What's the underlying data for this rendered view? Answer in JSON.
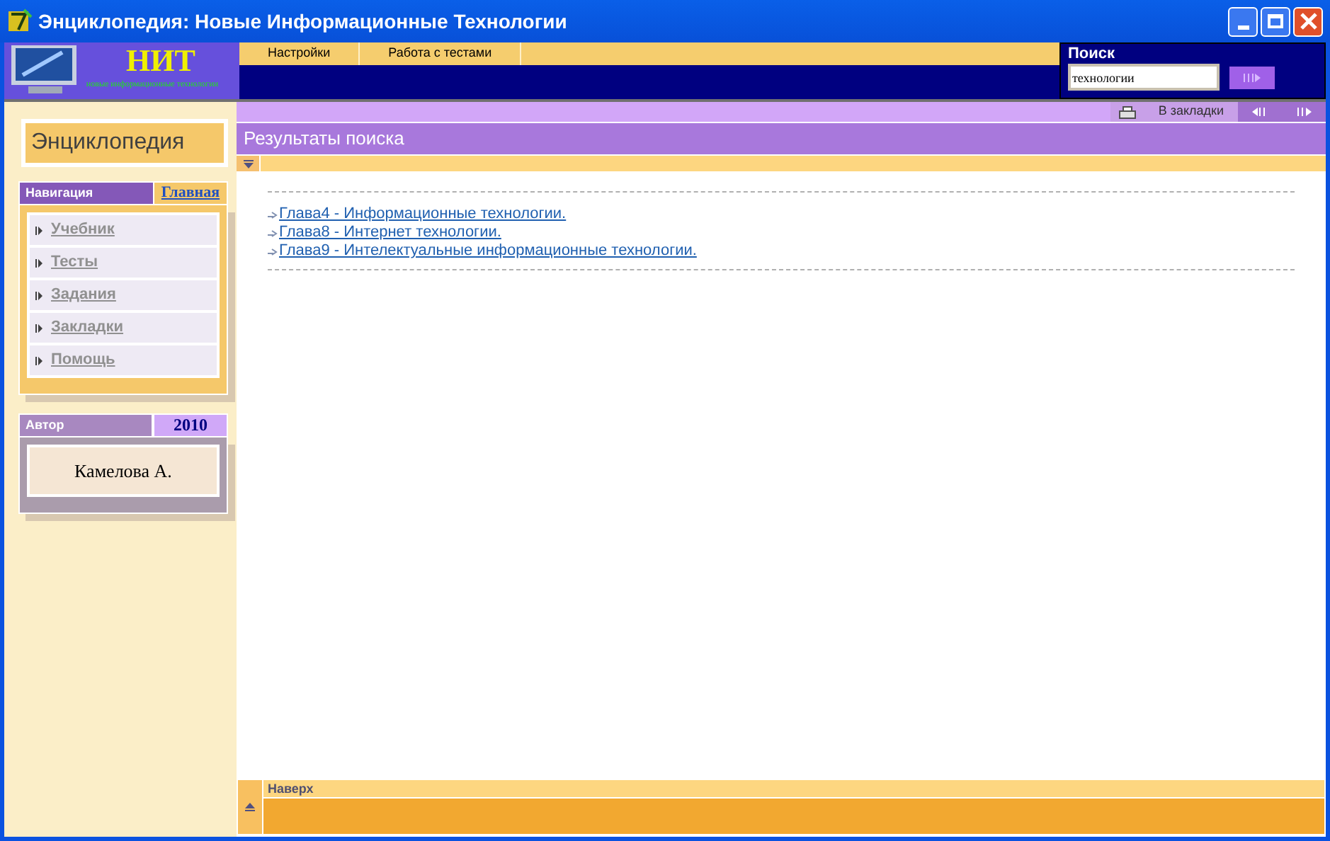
{
  "window": {
    "title": "Энциклопедия: Новые Информационные Технологии"
  },
  "logo": {
    "title": "НИТ",
    "subtitle": "новые информационные технологии"
  },
  "menu": [
    "Настройки",
    "Работа с тестами"
  ],
  "search": {
    "label": "Поиск",
    "value": "технологии"
  },
  "toolbar": {
    "bookmark": "В закладки"
  },
  "sidebar": {
    "title": "Энциклопедия",
    "nav_label": "Навигация",
    "home_link": "Главная",
    "items": [
      "Учебник",
      "Тесты",
      "Задания",
      "Закладки",
      "Помощь"
    ],
    "author_label": "Автор",
    "year": "2010",
    "author": "Камелова А."
  },
  "content": {
    "title": "Результаты поиска",
    "results": [
      "Глава4 - Информационные технологии.",
      "Глава8 - Интернет технологии.",
      "Глава9 - Интелектуальные информационные технологии."
    ]
  },
  "footer": {
    "label": "Наверх"
  }
}
